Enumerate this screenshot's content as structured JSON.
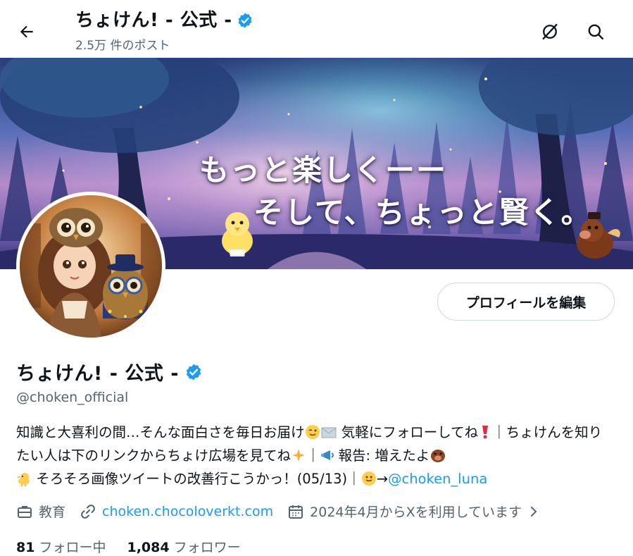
{
  "header": {
    "title": "ちょけん! - 公式 -",
    "post_count": "2.5万 件のポスト"
  },
  "banner": {
    "line1": "もっと楽しくーー",
    "line2": "そして、ちょっと賢く。"
  },
  "profile": {
    "edit_button": "プロフィールを編集",
    "name": "ちょけん! - 公式 -",
    "handle": "@choken_official",
    "bio_part1": "知識と大喜利の間…そんな面白さを毎日お届け",
    "bio_part2": " 気軽にフォローしてね",
    "bio_part3": "｜ちょけんを知りたい人は下のリンクからちょけ広場を見てね",
    "bio_part4": "｜",
    "bio_part5": "報告: 増えたよ",
    "bio_part6": " そろそろ画像ツイートの改善行こうかっ！(05/13)｜",
    "bio_part7": "→",
    "bio_mention": "@choken_luna",
    "category": "教育",
    "website": "choken.chocoloverkt.com",
    "joined": "2024年4月からXを利用しています",
    "following_count": "81",
    "following_label": "フォロー中",
    "followers_count": "1,084",
    "followers_label": "フォロワー"
  },
  "colors": {
    "accent": "#1d9bf0",
    "secondary_text": "#536471",
    "primary_text": "#0f1419",
    "verified": "#1d9bf0"
  },
  "icons": {
    "back": "arrow-left-icon",
    "grok": "grok-icon",
    "search": "search-icon",
    "verified": "verified-badge-icon",
    "category": "briefcase-icon",
    "website": "link-icon",
    "joined": "calendar-icon"
  }
}
